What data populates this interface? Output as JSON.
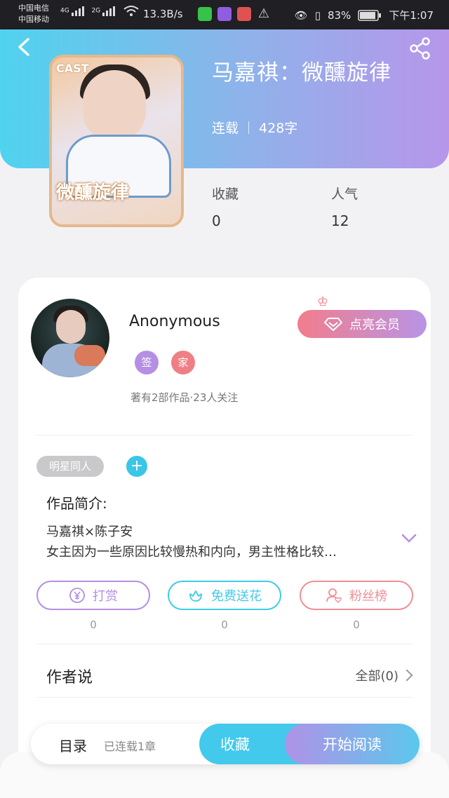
{
  "status_bar": {
    "carrier_1": "中国电信",
    "carrier_2": "中国移动",
    "net_1": "4G",
    "net_2": "2G",
    "speed": "13.3B/s",
    "battery": "83%",
    "time": "下午1:07"
  },
  "book": {
    "cover_cast": "CAST",
    "cover_title": "微醺旋律",
    "title": "马嘉祺：微醺旋律",
    "status": "连载",
    "words": "428字",
    "stats": [
      {
        "label": "收藏",
        "value": "0"
      },
      {
        "label": "人气",
        "value": "12"
      }
    ]
  },
  "author": {
    "name": "Anonymous",
    "badges": [
      "签",
      "家"
    ],
    "meta": "著有2部作品·23人关注",
    "vip_label": "点亮会员",
    "tag": "明星同人",
    "add_tag": "+"
  },
  "intro": {
    "label": "作品简介:",
    "line1": "马嘉祺×陈子安",
    "line2": "女主因为一些原因比较慢热和内向，男主性格比较…"
  },
  "actions": [
    {
      "label": "打赏",
      "count": "0",
      "color": "#b48fe3"
    },
    {
      "label": "免费送花",
      "count": "0",
      "color": "#3fcbe8"
    },
    {
      "label": "粉丝榜",
      "count": "0",
      "color": "#ef8f95"
    }
  ],
  "author_says": {
    "label": "作者说",
    "all": "全部(0)"
  },
  "bottom": {
    "toc": "目录",
    "toc_sub": "已连载1章",
    "favorite": "收藏",
    "start_reading": "开始阅读"
  },
  "colors": {
    "accent_cyan": "#43c9ec",
    "accent_purple": "#b796ea",
    "accent_pink": "#f27d8c"
  },
  "icons": [
    "back-icon",
    "share-icon",
    "crown-icon",
    "diamond-icon",
    "yen-icon",
    "flower-icon",
    "user-icon",
    "chevron-down-icon",
    "chevron-right-icon"
  ]
}
